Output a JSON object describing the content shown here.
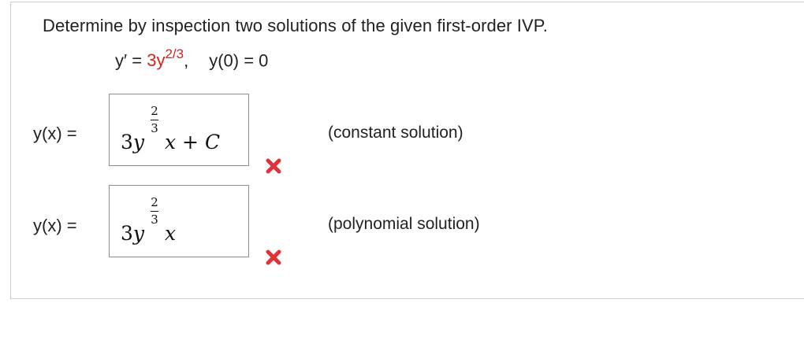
{
  "question": {
    "prompt": "Determine by inspection two solutions of the given first-order IVP.",
    "equation": {
      "lhs": "y′ = ",
      "coef": "3y",
      "exponent": "2/3",
      "comma": ",",
      "initial": "y(0) = 0"
    }
  },
  "answers": [
    {
      "label": "y(x) =",
      "coef": "3",
      "y": "y",
      "exp_num": "2",
      "exp_den": "3",
      "rest": "x + C",
      "note": "(constant solution)",
      "status": "incorrect",
      "status_icon": "cross-icon",
      "status_color": "#e0323a"
    },
    {
      "label": "y(x) =",
      "coef": "3",
      "y": "y",
      "exp_num": "2",
      "exp_den": "3",
      "rest": "x",
      "note": "(polynomial solution)",
      "status": "incorrect",
      "status_icon": "cross-icon",
      "status_color": "#e0323a"
    }
  ]
}
